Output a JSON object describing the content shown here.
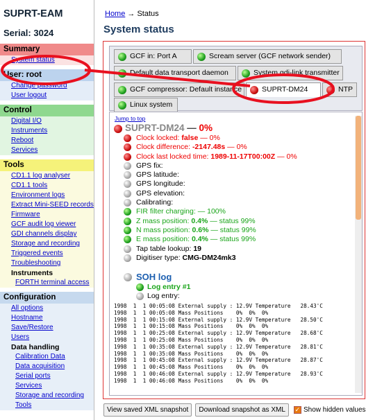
{
  "sidebar": {
    "app_title": "SUPRT-EAM",
    "serial": "Serial: 3024",
    "sections": [
      {
        "title": "Summary",
        "items": [
          {
            "label": "System status"
          }
        ]
      },
      {
        "title": "User: root",
        "items": [
          {
            "label": "Change password"
          },
          {
            "label": "User logout"
          }
        ]
      },
      {
        "title": "Control",
        "items": [
          {
            "label": "Digital I/O"
          },
          {
            "label": "Instruments"
          },
          {
            "label": "Reboot"
          },
          {
            "label": "Services"
          }
        ]
      },
      {
        "title": "Tools",
        "items": [
          {
            "label": "CD1.1 log analyser"
          },
          {
            "label": "CD1.1 tools"
          },
          {
            "label": "Environment logs"
          },
          {
            "label": "Extract Mini-SEED records"
          },
          {
            "label": "Firmware"
          },
          {
            "label": "GCF audit log viewer"
          },
          {
            "label": "GDI channels display"
          },
          {
            "label": "Storage and recording"
          },
          {
            "label": "Triggered events"
          },
          {
            "label": "Troubleshooting"
          },
          {
            "label": "Instruments"
          },
          {
            "label": "FORTH terminal access"
          }
        ]
      },
      {
        "title": "Configuration",
        "items": [
          {
            "label": "All options"
          },
          {
            "label": "Hostname"
          },
          {
            "label": "Save/Restore"
          },
          {
            "label": "Users"
          },
          {
            "label": "Data handling"
          },
          {
            "label": "Calibration Data"
          },
          {
            "label": "Data acquisition"
          },
          {
            "label": "Serial ports"
          },
          {
            "label": "Services"
          },
          {
            "label": "Storage and recording"
          },
          {
            "label": "Tools"
          }
        ]
      }
    ]
  },
  "breadcrumb": {
    "home": "Home",
    "arrow": "→",
    "current": "Status"
  },
  "page_title": "System status",
  "tabs": [
    {
      "label": "GCF in: Port A",
      "status": "green"
    },
    {
      "label": "Scream server (GCF network sender)",
      "status": "green"
    },
    {
      "label": "Default data transport daemon",
      "status": "green"
    },
    {
      "label": "System gdi-link transmitter",
      "status": "green"
    },
    {
      "label": "GCF compressor: Default instance",
      "status": "green"
    },
    {
      "label": "SUPRT-DM24",
      "status": "red"
    },
    {
      "label": "NTP",
      "status": "red"
    },
    {
      "label": "Linux system",
      "status": "green"
    }
  ],
  "content": {
    "jump_link": "Jump to top",
    "device_name": "SUPRT-DM24",
    "device_sep": " — ",
    "device_pct": "0%",
    "rows": [
      {
        "label": "Clock locked: ",
        "value": "false",
        "suffix": " — 0%",
        "status": "red",
        "color": "red"
      },
      {
        "label": "Clock difference: ",
        "value": "-2147.48s",
        "suffix": " — 0%",
        "status": "red",
        "color": "red"
      },
      {
        "label": "Clock last locked time: ",
        "value": "1989-11-17T00:00Z",
        "suffix": " — 0%",
        "status": "red",
        "color": "red"
      },
      {
        "label": "GPS fix:",
        "value": "",
        "suffix": "",
        "status": "grey",
        "color": "black"
      },
      {
        "label": "GPS latitude:",
        "value": "",
        "suffix": "",
        "status": "grey",
        "color": "black"
      },
      {
        "label": "GPS longitude:",
        "value": "",
        "suffix": "",
        "status": "grey",
        "color": "black"
      },
      {
        "label": "GPS elevation:",
        "value": "",
        "suffix": "",
        "status": "grey",
        "color": "black"
      },
      {
        "label": "Calibrating:",
        "value": "",
        "suffix": "",
        "status": "grey",
        "color": "black"
      },
      {
        "label": "FIR filter charging: ",
        "value": "",
        "suffix": "— 100%",
        "status": "green",
        "color": "green"
      },
      {
        "label": "Z mass position: ",
        "value": "0.4%",
        "suffix": " — status 99%",
        "status": "green",
        "color": "green"
      },
      {
        "label": "N mass position: ",
        "value": "0.6%",
        "suffix": " — status 99%",
        "status": "green",
        "color": "green"
      },
      {
        "label": "E mass position: ",
        "value": "0.4%",
        "suffix": " — status 99%",
        "status": "green",
        "color": "green"
      },
      {
        "label": "Tap table lookup: ",
        "value": "19",
        "suffix": "",
        "status": "grey",
        "color": "black"
      },
      {
        "label": "Digitiser type: ",
        "value": "CMG-DM24mk3",
        "suffix": "",
        "status": "grey",
        "color": "black"
      }
    ],
    "soh_title": "SOH log",
    "log_entry_title": "Log entry #1",
    "log_entry_label": "Log entry:",
    "log_lines": [
      "1998  1  1 00:05:08 External supply : 12.9V Temperature   28.43'C",
      "1998  1  1 00:05:08 Mass Positions    0%  0%  0%",
      "1998  1  1 00:15:08 External supply : 12.9V Temperature   28.50'C",
      "1998  1  1 00:15:08 Mass Positions    0%  0%  0%",
      "1998  1  1 00:25:08 External supply : 12.9V Temperature   28.68'C",
      "1998  1  1 00:25:08 Mass Positions    0%  0%  0%",
      "1998  1  1 00:35:08 External supply : 12.9V Temperature   28.81'C",
      "1998  1  1 00:35:08 Mass Positions    0%  0%  0%",
      "1998  1  1 00:45:08 External supply : 12.9V Temperature   28.87'C",
      "1998  1  1 00:45:08 Mass Positions    0%  0%  0%",
      "1998  1  1 00:46:08 External supply : 12.9V Temperature   28.93'C",
      "1998  1  1 00:46:08 Mass Positions    0%  0%  0%"
    ]
  },
  "footer": {
    "view_xml": "View saved XML snapshot",
    "download_xml": "Download snapshot as XML",
    "show_hidden": "Show hidden values",
    "show_hidden_checked": true
  },
  "colors": {
    "annotation": "#e8101f",
    "accent": "#1d3b5e",
    "link": "#0000cc"
  }
}
